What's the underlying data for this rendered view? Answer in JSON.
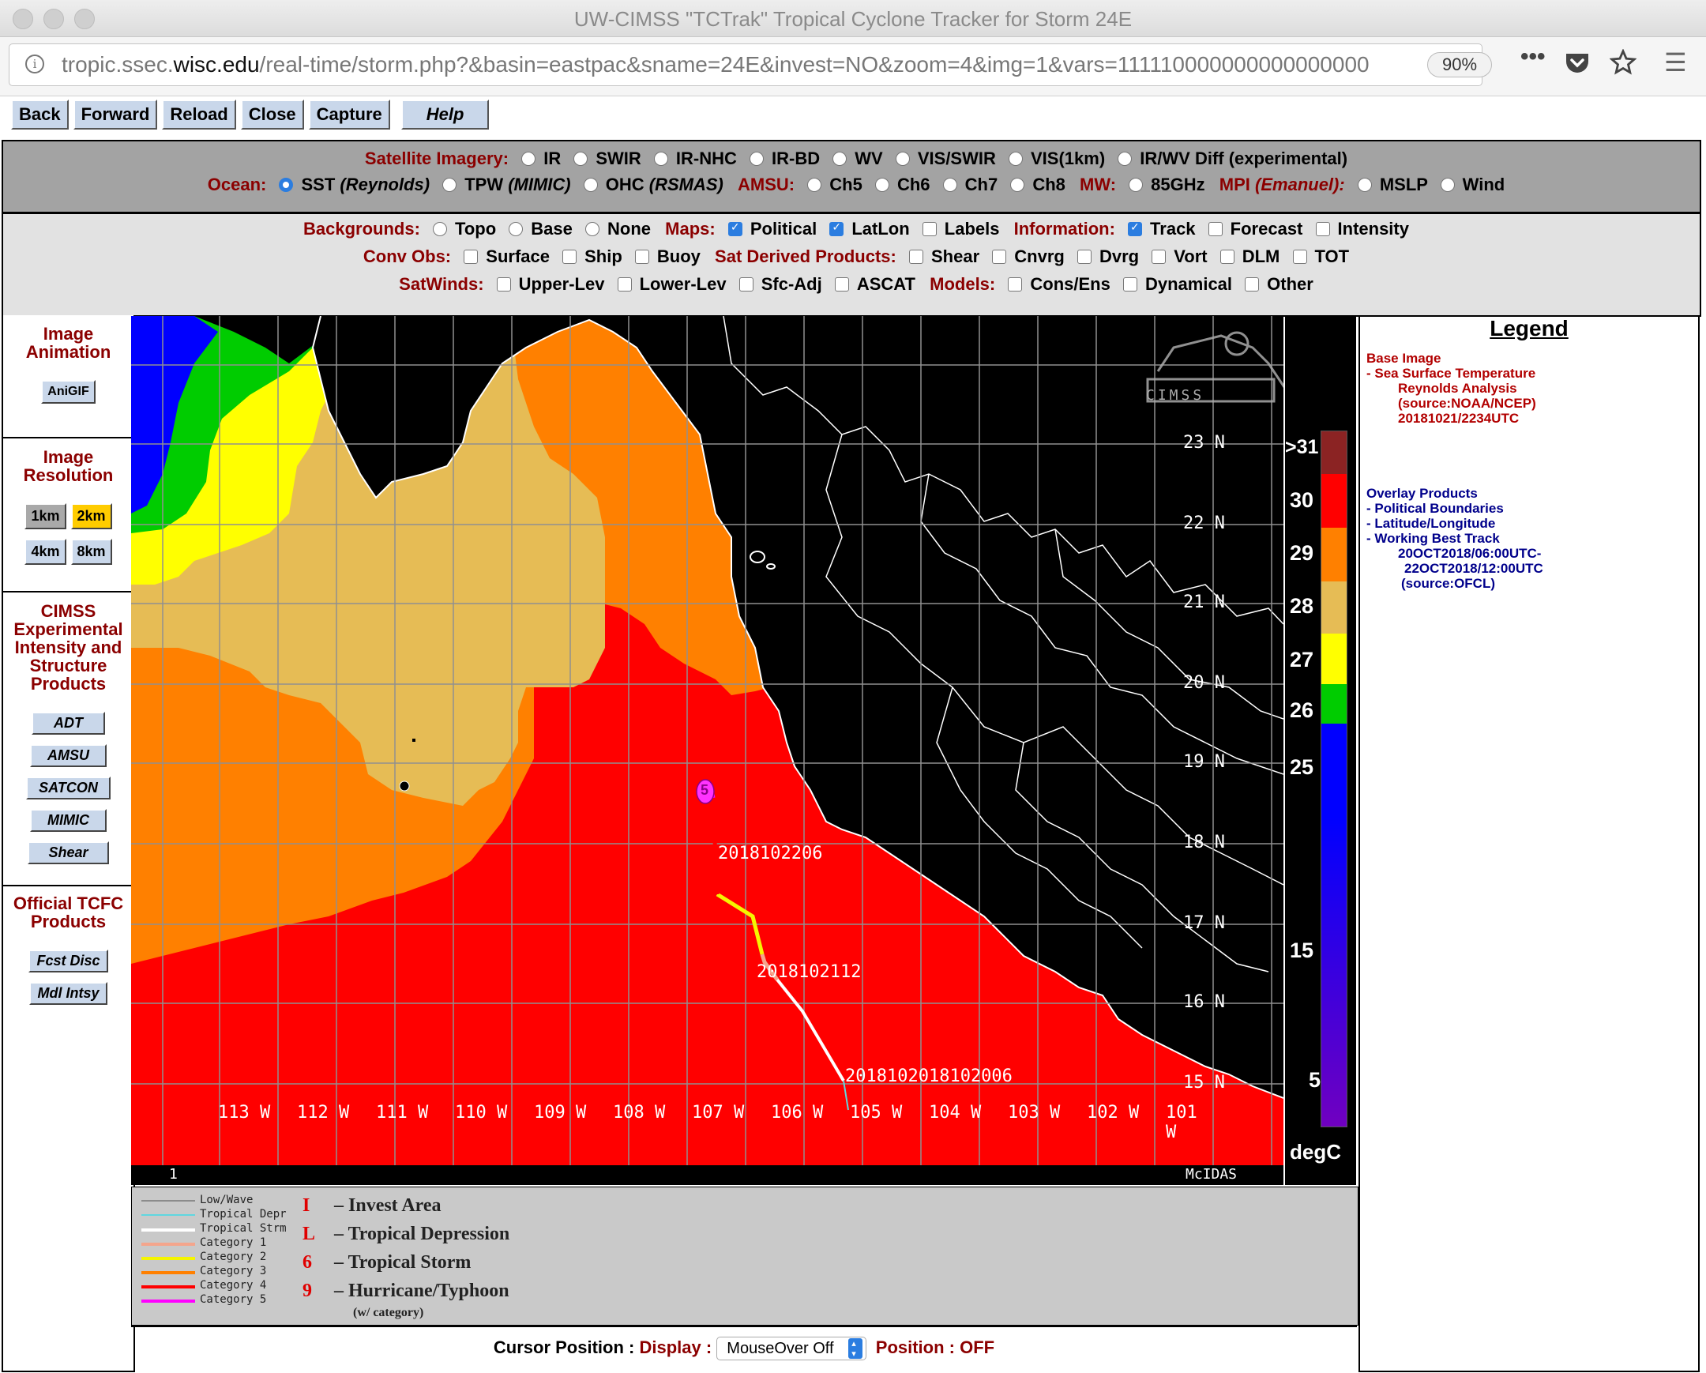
{
  "window": {
    "title": "UW-CIMSS \"TCTrak\" Tropical Cyclone Tracker for Storm 24E"
  },
  "browser": {
    "url_host": "tropic.ssec.",
    "url_domain": "wisc.edu",
    "url_path": "/real-time/storm.php?&basin=eastpac&sname=24E&invest=NO&zoom=4&img=1&vars=111110000000000000000",
    "zoom": "90%",
    "more_icon": "•••"
  },
  "toolbar": {
    "buttons": [
      "Back",
      "Forward",
      "Reload",
      "Close",
      "Capture",
      "Help"
    ]
  },
  "satellite": {
    "label": "Satellite Imagery:",
    "options": [
      "IR",
      "SWIR",
      "IR-NHC",
      "IR-BD",
      "WV",
      "VIS/SWIR",
      "VIS(1km)",
      "IR/WV Diff (experimental)"
    ]
  },
  "ocean": {
    "label": "Ocean:",
    "sst": "SST",
    "sst_src": "(Reynolds)",
    "tpw": "TPW",
    "tpw_src": "(MIMIC)",
    "ohc": "OHC",
    "ohc_src": "(RSMAS)",
    "amsu_label": "AMSU:",
    "amsu": [
      "Ch5",
      "Ch6",
      "Ch7",
      "Ch8"
    ],
    "mw_label": "MW:",
    "mw": "85GHz",
    "mpi_label": "MPI",
    "mpi_src": "(Emanuel):",
    "mpi": [
      "MSLP",
      "Wind"
    ]
  },
  "backgrounds": {
    "label": "Backgrounds:",
    "options": [
      "Topo",
      "Base",
      "None"
    ]
  },
  "maps": {
    "label": "Maps:",
    "options": [
      "Political",
      "LatLon",
      "Labels"
    ]
  },
  "information": {
    "label": "Information:",
    "options": [
      "Track",
      "Forecast",
      "Intensity"
    ]
  },
  "convobs": {
    "label": "Conv Obs:",
    "options": [
      "Surface",
      "Ship",
      "Buoy"
    ]
  },
  "satderived": {
    "label": "Sat Derived Products:",
    "options": [
      "Shear",
      "Cnvrg",
      "Dvrg",
      "Vort",
      "DLM",
      "TOT"
    ]
  },
  "satwinds": {
    "label": "SatWinds:",
    "options": [
      "Upper-Lev",
      "Lower-Lev",
      "Sfc-Adj",
      "ASCAT"
    ]
  },
  "models": {
    "label": "Models:",
    "options": [
      "Cons/Ens",
      "Dynamical",
      "Other"
    ]
  },
  "sidebar": {
    "anim_title": "Image Animation",
    "anigif": "AniGIF",
    "res_title": "Image Resolution",
    "res": [
      "1km",
      "2km",
      "4km",
      "8km"
    ],
    "cimss_title": "CIMSS Experimental Intensity and Structure Products",
    "cimss": [
      "ADT",
      "AMSU",
      "SATCON",
      "MIMIC",
      "Shear"
    ],
    "tcfc_title": "Official TCFC Products",
    "tcfc": [
      "Fcst Disc",
      "Mdl Intsy"
    ]
  },
  "map": {
    "lat_labels": [
      "23 N",
      "22 N",
      "21 N",
      "20 N",
      "19 N",
      "18 N",
      "17 N",
      "16 N",
      "15 N"
    ],
    "lon_labels": [
      "113 W",
      "112 W",
      "111 W",
      "110 W",
      "109 W",
      "108 W",
      "107 W",
      "106 W",
      "105 W",
      "104 W",
      "103 W",
      "102 W",
      "101 W"
    ],
    "track_labels": [
      "2018102206",
      "2018102112",
      "2018102018102006"
    ],
    "storm_cat": "5",
    "frame": "1",
    "mcidas": "McIDAS",
    "logo": "CIMSS"
  },
  "colorbar": {
    "labels": [
      ">31",
      "30",
      "29",
      "28",
      "27",
      "26",
      "25",
      "15",
      "5"
    ],
    "unit": "degC"
  },
  "legend": {
    "title": "Legend",
    "base_image": "Base Image",
    "base_lines": [
      "-  Sea Surface Temperature",
      "Reynolds Analysis",
      "(source:NOAA/NCEP)",
      "20181021/2234UTC"
    ],
    "overlay": "Overlay Products",
    "overlay_lines": [
      "-  Political Boundaries",
      "-  Latitude/Longitude",
      "-  Working Best Track",
      "20OCT2018/06:00UTC-",
      "22OCT2018/12:00UTC",
      "(source:OFCL)"
    ]
  },
  "track_legend": {
    "lines": [
      "Low/Wave",
      "Tropical Depr",
      "Tropical Strm",
      "Category 1",
      "Category 2",
      "Category 3",
      "Category 4",
      "Category 5"
    ],
    "colors": [
      "#8c8c8c",
      "#5fd7e0",
      "#ffffff",
      "#f4a58c",
      "#f5f500",
      "#ff8000",
      "#ff0000",
      "#ff00ff"
    ],
    "symbols": [
      "I",
      "L",
      "6",
      "9"
    ],
    "symbol_labels": [
      "– Invest Area",
      "– Tropical Depression",
      "– Tropical Storm",
      "– Hurricane/Typhoon"
    ],
    "category_note": "(w/ category)"
  },
  "cursor": {
    "label": "Cursor Position :",
    "display_label": "Display :",
    "display_value": "MouseOver Off",
    "position_label": "Position : OFF"
  },
  "colors": {
    "sst_31": "#8b2323",
    "sst_30": "#ff0000",
    "sst_29": "#ff8000",
    "sst_28": "#e6bc55",
    "sst_27": "#ffff00",
    "sst_26": "#00cc00",
    "sst_25": "#0000ff",
    "land": "#000000"
  }
}
